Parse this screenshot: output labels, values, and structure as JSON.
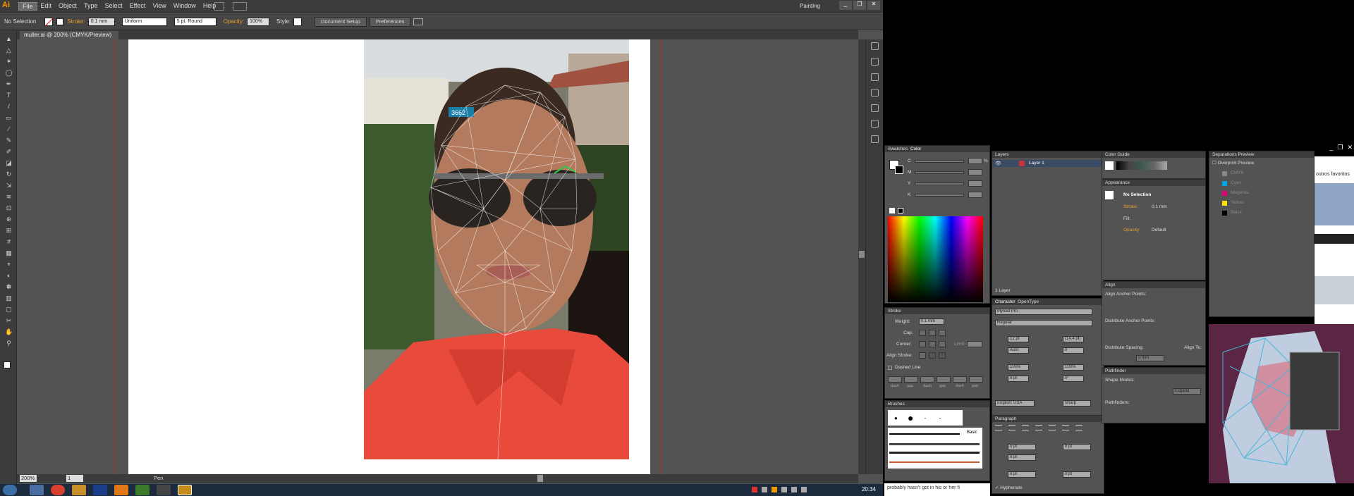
{
  "app": {
    "logo": "Ai",
    "workspace": "Painting"
  },
  "menu": {
    "items": [
      "File",
      "Edit",
      "Object",
      "Type",
      "Select",
      "Effect",
      "View",
      "Window",
      "Help"
    ]
  },
  "control_bar": {
    "selection": "No Selection",
    "stroke_label": "Stroke:",
    "stroke_value": "0.1 mm",
    "profile": "Uniform",
    "brush": "5 pt. Round",
    "opacity_label": "Opacity:",
    "opacity_value": "100%",
    "style_label": "Style:",
    "document_setup": "Document Setup",
    "preferences": "Preferences"
  },
  "document": {
    "tab": "muller.ai @ 200% (CMYK/Preview)"
  },
  "status": {
    "zoom": "200%",
    "page": "1",
    "tool": "Pen"
  },
  "taskbar": {
    "clock": "20:34"
  },
  "photo": {
    "watermark": "3662"
  },
  "color_panel": {
    "tabs": [
      "Swatches",
      "Color"
    ],
    "channels": [
      "C",
      "M",
      "Y",
      "K"
    ],
    "unit": "%"
  },
  "layers_panel": {
    "title": "Layers",
    "layer": "Layer 1",
    "footer": "1 Layer"
  },
  "color_guide_panel": {
    "title": "Color Guide"
  },
  "appearance_panel": {
    "title": "Appearance",
    "selection": "No Selection",
    "stroke_label": "Stroke:",
    "stroke_value": "0.1 mm",
    "fill_label": "Fill:",
    "opacity_label": "Opacity:",
    "opacity_value": "Default"
  },
  "separations_panel": {
    "title": "Separations Preview",
    "overprint": "Overprint Preview",
    "plates": [
      "CMYK",
      "Cyan",
      "Magenta",
      "Yellow",
      "Black"
    ]
  },
  "stroke_panel": {
    "title": "Stroke",
    "weight_label": "Weight:",
    "weight_value": "0.1 mm",
    "cap_label": "Cap:",
    "corner_label": "Corner:",
    "limit_label": "Limit:",
    "align_label": "Align Stroke:",
    "dashed": "Dashed Line",
    "dash_labels": [
      "dash",
      "gap",
      "dash",
      "gap",
      "dash",
      "gap"
    ]
  },
  "character_panel": {
    "tabs": [
      "Character",
      "OpenType"
    ],
    "font": "Myriad Pro",
    "style": "Regular",
    "size": "12 pt",
    "leading": "(14.4 pt)",
    "kerning": "Auto",
    "tracking": "0",
    "vscale": "100%",
    "hscale": "100%",
    "baseline": "0 pt",
    "rotation": "0°",
    "language": "English: USA",
    "aa": "Sharp"
  },
  "paragraph_panel": {
    "title": "Paragraph",
    "indent_left": "0 pt",
    "indent_right": "0 pt",
    "first": "0 pt",
    "space_before": "0 pt",
    "space_after": "0 pt",
    "hyphenate": "Hyphenate"
  },
  "align_panel": {
    "title": "Align",
    "anchor": "Align Anchor Points:",
    "distribute": "Distribute Anchor Points:",
    "spacing": "Distribute Spacing:",
    "align_to": "Align To:",
    "spacing_value": "0 mm"
  },
  "pathfinder_panel": {
    "title": "Pathfinder",
    "shape_modes": "Shape Modes:",
    "expand": "Expand",
    "pathfinders": "Pathfinders:"
  },
  "brushes_panel": {
    "title": "Brushes",
    "basic": "Basic"
  },
  "browser_fragment": {
    "bookmarks": "outros favoritos"
  },
  "bottom_text": "probably hasn't got in his or her fi"
}
